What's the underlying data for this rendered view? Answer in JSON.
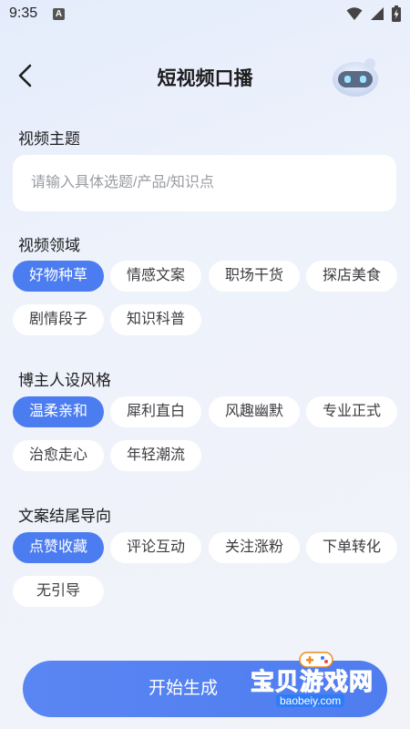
{
  "status_bar": {
    "time": "9:35",
    "notification_letter": "A"
  },
  "header": {
    "title": "短视频口播"
  },
  "topic": {
    "label": "视频主题",
    "placeholder": "请输入具体选题/产品/知识点"
  },
  "domain": {
    "label": "视频领域",
    "options": [
      "好物种草",
      "情感文案",
      "职场干货",
      "探店美食",
      "剧情段子",
      "知识科普"
    ],
    "selected": "好物种草"
  },
  "persona_style": {
    "label": "博主人设风格",
    "options": [
      "温柔亲和",
      "犀利直白",
      "风趣幽默",
      "专业正式",
      "治愈走心",
      "年轻潮流"
    ],
    "selected": "温柔亲和"
  },
  "ending_guide": {
    "label": "文案结尾导向",
    "options": [
      "点赞收藏",
      "评论互动",
      "关注涨粉",
      "下单转化",
      "无引导"
    ],
    "selected": "点赞收藏"
  },
  "action": {
    "start_label": "开始生成"
  },
  "watermark": {
    "brand": "宝贝游戏网",
    "url": "baobeiy.com"
  },
  "colors": {
    "accent": "#4b7cf0",
    "chip_bg": "#ffffff",
    "page_bg": "#eef2fb"
  }
}
